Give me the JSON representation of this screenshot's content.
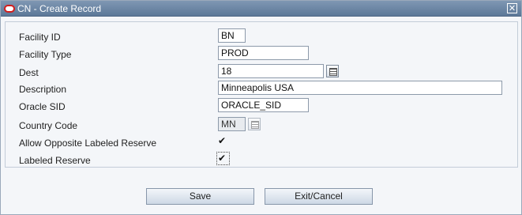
{
  "window": {
    "title": "CN - Create Record",
    "close_glyph": "✕"
  },
  "form": {
    "facility_id": {
      "label": "Facility ID",
      "value": "BN"
    },
    "facility_type": {
      "label": "Facility Type",
      "value": "PROD"
    },
    "dest": {
      "label": "Dest",
      "value": "18"
    },
    "description": {
      "label": "Description",
      "value": "Minneapolis USA"
    },
    "oracle_sid": {
      "label": "Oracle SID",
      "value": "ORACLE_SID"
    },
    "country_code": {
      "label": "Country Code",
      "value": "MN"
    },
    "allow_opposite": {
      "label": "Allow Opposite Labeled Reserve",
      "checked": true,
      "glyph": "✔"
    },
    "labeled_reserve": {
      "label": "Labeled Reserve",
      "checked": true,
      "glyph": "✔"
    }
  },
  "buttons": {
    "save": "Save",
    "exit_cancel": "Exit/Cancel"
  },
  "colors": {
    "titlebar": "#6d87a6",
    "panel_bg": "#f4f6f9",
    "logo": "#d21d1d"
  },
  "icons": [
    "oracle-logo-icon",
    "close-icon",
    "lookup-icon",
    "checkbox"
  ]
}
